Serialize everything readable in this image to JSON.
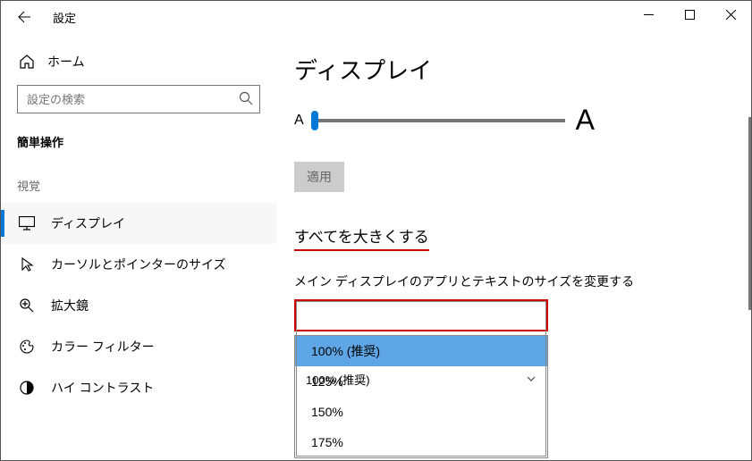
{
  "window": {
    "title": "設定"
  },
  "sidebar": {
    "home": "ホーム",
    "search_placeholder": "設定の検索",
    "section": "簡単操作",
    "group": "視覚",
    "items": [
      {
        "label": "ディスプレイ"
      },
      {
        "label": "カーソルとポインターのサイズ"
      },
      {
        "label": "拡大鏡"
      },
      {
        "label": "カラー フィルター"
      },
      {
        "label": "ハイ コントラスト"
      }
    ]
  },
  "main": {
    "heading": "ディスプレイ",
    "apply": "適用",
    "subheading": "すべてを大きくする",
    "field_label": "メイン ディスプレイのアプリとテキストのサイズを変更する",
    "selected": "100% (推奨)",
    "options": [
      "100% (推奨)",
      "125%",
      "150%",
      "175%"
    ]
  }
}
